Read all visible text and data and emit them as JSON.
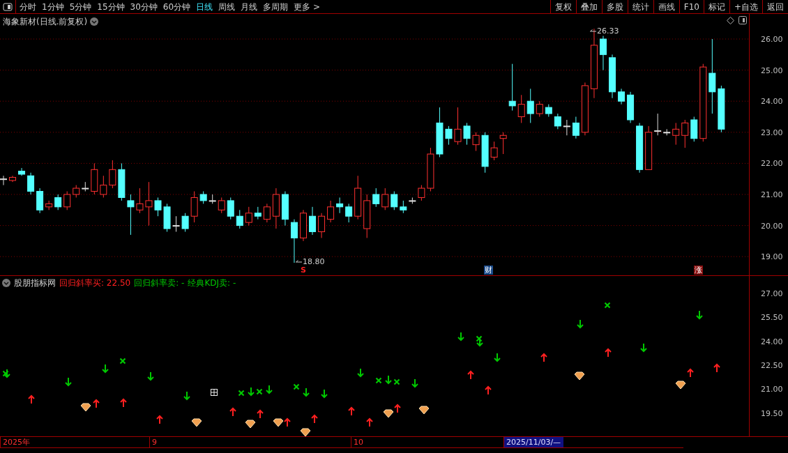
{
  "toolbar": {
    "periods": [
      {
        "label": "分时",
        "selected": false
      },
      {
        "label": "1分钟",
        "selected": false
      },
      {
        "label": "5分钟",
        "selected": false
      },
      {
        "label": "15分钟",
        "selected": false
      },
      {
        "label": "30分钟",
        "selected": false
      },
      {
        "label": "60分钟",
        "selected": false
      },
      {
        "label": "日线",
        "selected": true
      },
      {
        "label": "周线",
        "selected": false
      },
      {
        "label": "月线",
        "selected": false
      },
      {
        "label": "多周期",
        "selected": false
      },
      {
        "label": "更多 >",
        "selected": false
      }
    ],
    "actions": [
      "复权",
      "叠加",
      "多股",
      "统计",
      "画线",
      "F10",
      "标记",
      "+自选",
      "返回"
    ]
  },
  "main_chart": {
    "title": "海象新材(日线.前复权)",
    "y_labels": [
      "26.00",
      "25.00",
      "24.00",
      "23.00",
      "22.00",
      "21.00",
      "20.00",
      "19.00"
    ],
    "high_label": "26.33",
    "low_label": "18.80",
    "event_marks": [
      {
        "text": "S",
        "kind": "signal"
      },
      {
        "text": "财",
        "kind": "finance"
      },
      {
        "text": "涨",
        "kind": "limit"
      }
    ]
  },
  "indicator": {
    "name": "股朋指标网",
    "values": [
      {
        "text": "回归斜率买: 22.50",
        "kind": "buy"
      },
      {
        "text": "回归斜率卖: -",
        "kind": "sell"
      },
      {
        "text": "经典KDJ卖: -",
        "kind": "sell"
      }
    ],
    "y_labels": [
      "27.00",
      "25.50",
      "24.00",
      "22.50",
      "21.00",
      "19.50"
    ]
  },
  "date_axis": [
    {
      "label": "2025年",
      "selected": false
    },
    {
      "label": "9",
      "selected": false
    },
    {
      "label": "10",
      "selected": false
    },
    {
      "label": "2025/11/03/—",
      "selected": true
    }
  ]
}
